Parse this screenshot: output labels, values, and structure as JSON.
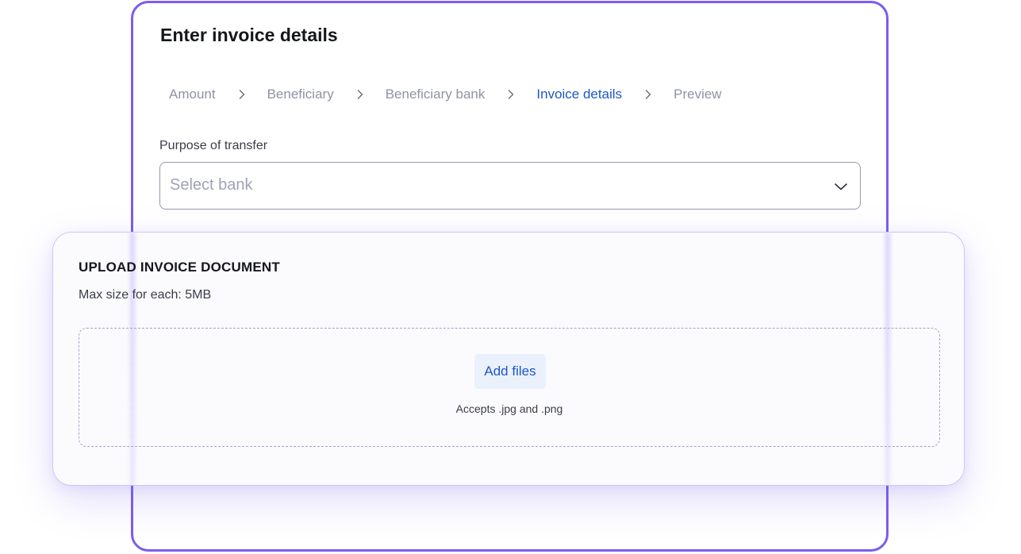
{
  "page": {
    "title": "Enter invoice details"
  },
  "stepper": {
    "steps": [
      {
        "label": "Amount",
        "state": "inactive"
      },
      {
        "label": "Beneficiary",
        "state": "inactive"
      },
      {
        "label": "Beneficiary bank",
        "state": "inactive"
      },
      {
        "label": "Invoice details",
        "state": "active"
      },
      {
        "label": "Preview",
        "state": "inactive"
      }
    ]
  },
  "purpose": {
    "label": "Purpose of transfer",
    "placeholder": "Select bank",
    "icon": "chevron-down-icon"
  },
  "upload": {
    "title": "UPLOAD INVOICE DOCUMENT",
    "max_size": "Max size for each: 5MB",
    "button_label": "Add files",
    "accepts": "Accepts .jpg and .png"
  },
  "colors": {
    "accent": "#7c5cf0",
    "link_active": "#1f56c7",
    "muted_text": "#8f93a3",
    "button_bg": "#eaf1fd"
  }
}
